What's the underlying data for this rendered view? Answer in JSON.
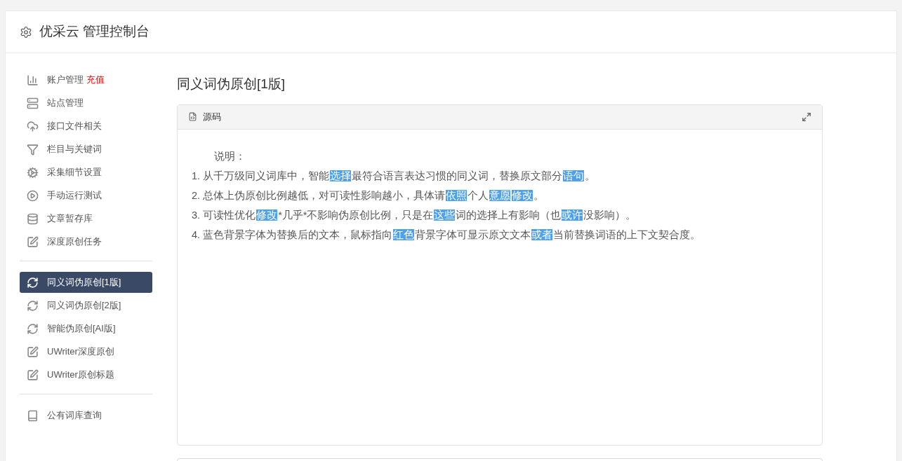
{
  "header": {
    "title": "优采云 管理控制台"
  },
  "sidebar": {
    "groups": [
      [
        {
          "label": "账户管理",
          "badge": "充值",
          "selected": false
        },
        {
          "label": "站点管理",
          "selected": false
        },
        {
          "label": "接口文件相关",
          "selected": false
        },
        {
          "label": "栏目与关键词",
          "selected": false
        },
        {
          "label": "采集细节设置",
          "selected": false
        },
        {
          "label": "手动运行测试",
          "selected": false
        },
        {
          "label": "文章暂存库",
          "selected": false
        },
        {
          "label": "深度原创任务",
          "selected": false
        }
      ],
      [
        {
          "label": "同义词伪原创[1版]",
          "selected": true
        },
        {
          "label": "同义词伪原创[2版]",
          "selected": false
        },
        {
          "label": "智能伪原创[AI版]",
          "selected": false
        },
        {
          "label": "UWriter深度原创",
          "selected": false
        },
        {
          "label": "UWriter原创标题",
          "selected": false
        }
      ],
      [
        {
          "label": "公有词库查询",
          "selected": false
        }
      ]
    ]
  },
  "page_title": "同义词伪原创[1版]",
  "panel": {
    "title": "源码",
    "intro": "说明：",
    "lines": [
      [
        {
          "text": "1. 从千万级同义词库中，智能",
          "highlighted": false
        },
        {
          "text": "选择",
          "highlighted": true
        },
        {
          "text": "最符合语言表达习惯的同义词，替换原文部分",
          "highlighted": false
        },
        {
          "text": "语句",
          "highlighted": true
        },
        {
          "text": "。",
          "highlighted": false
        }
      ],
      [
        {
          "text": "2. 总体上伪原创比例越低，对可读性影响越小，具体请",
          "highlighted": false
        },
        {
          "text": "依照",
          "highlighted": true
        },
        {
          "text": "个人",
          "highlighted": false
        },
        {
          "text": "意愿",
          "highlighted": true
        },
        {
          "text": "修改",
          "highlighted": true
        },
        {
          "text": "。",
          "highlighted": false
        }
      ],
      [
        {
          "text": "3. 可读性优化",
          "highlighted": false
        },
        {
          "text": "修改",
          "highlighted": true
        },
        {
          "text": "*几乎*不影响伪原创比例，只是在",
          "highlighted": false
        },
        {
          "text": "这些",
          "highlighted": true
        },
        {
          "text": "词的选择上有影响（也",
          "highlighted": false
        },
        {
          "text": "或许",
          "highlighted": true
        },
        {
          "text": "没影响）。",
          "highlighted": false
        }
      ],
      [
        {
          "text": "4. 蓝色背景字体为替换后的文本，鼠标指向",
          "highlighted": false
        },
        {
          "text": "红色",
          "highlighted": true
        },
        {
          "text": "背景字体可显示原文文本",
          "highlighted": false
        },
        {
          "text": "或者",
          "highlighted": true
        },
        {
          "text": "当前替换词语的上下文契合度。",
          "highlighted": false
        }
      ]
    ]
  }
}
